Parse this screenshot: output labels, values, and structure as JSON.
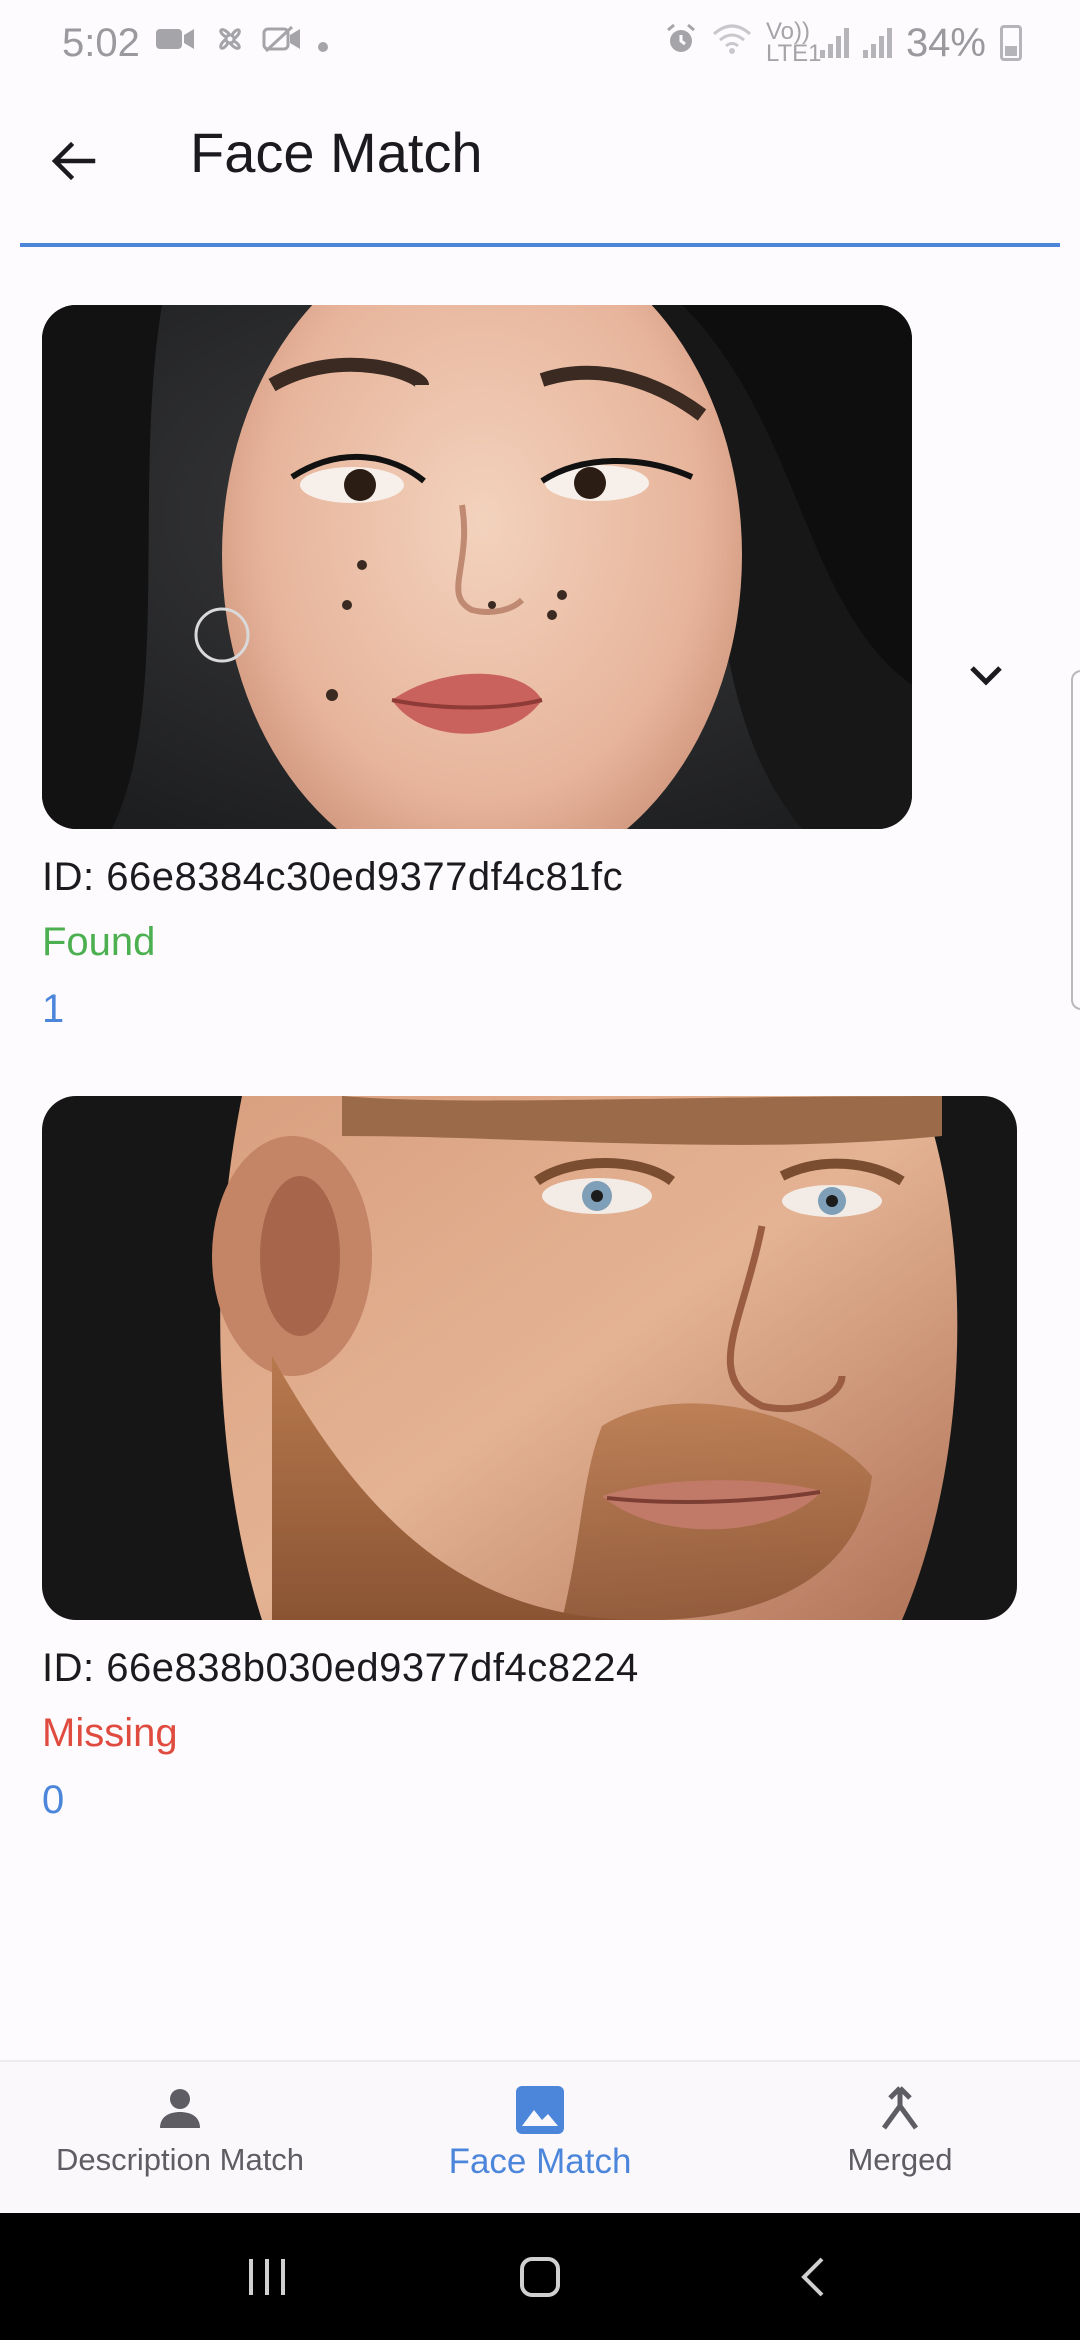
{
  "status_bar": {
    "time": "5:02",
    "battery": "34%",
    "network_label": "Vo)) LTE1"
  },
  "header": {
    "title": "Face Match"
  },
  "results": [
    {
      "id_text": "ID: 66e8384c30ed9377df4c81fc",
      "status": "Found",
      "status_color": "#4caf50",
      "count": "1"
    },
    {
      "id_text": "ID: 66e838b030ed9377df4c8224",
      "status": "Missing",
      "status_color": "#e04b3f",
      "count": "0"
    }
  ],
  "bottom_nav": {
    "items": [
      {
        "label": "Description Match",
        "icon": "person-icon",
        "active": false
      },
      {
        "label": "Face Match",
        "icon": "image-icon",
        "active": true
      },
      {
        "label": "Merged",
        "icon": "merge-icon",
        "active": false
      }
    ]
  },
  "colors": {
    "accent": "#4b86db",
    "found": "#4caf50",
    "missing": "#e04b3f"
  }
}
